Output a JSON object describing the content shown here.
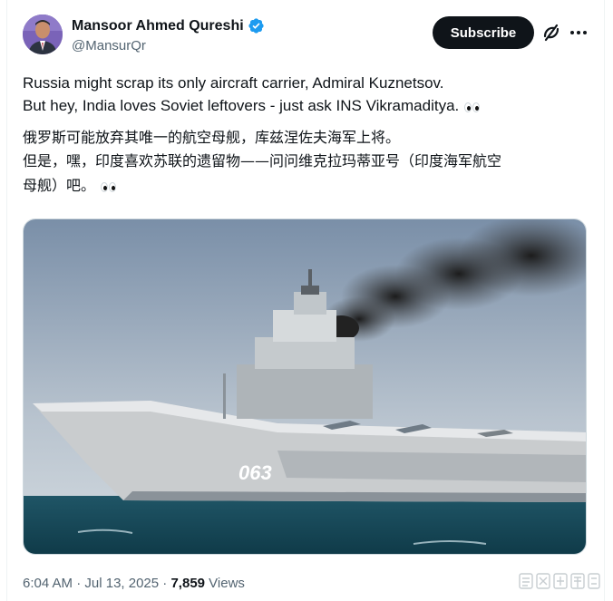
{
  "author": {
    "name": "Mansoor Ahmed Qureshi",
    "handle": "@MansurQr",
    "verified": true
  },
  "actions": {
    "subscribe_label": "Subscribe",
    "grok_icon": "grok-icon",
    "more_icon": "more-icon"
  },
  "post": {
    "line1": "Russia might scrap its only aircraft carrier, Admiral Kuznetsov.",
    "line2": "But hey, India loves Soviet leftovers - just ask INS Vikramaditya.",
    "line3": "俄罗斯可能放弃其唯一的航空母舰，库兹涅佐夫海军上将。",
    "line4": "但是，嘿，印度喜欢苏联的遗留物——问问维克拉玛蒂亚号（印度海军航空",
    "line5": "母舰）吧。",
    "emoji": "eyes-emoji"
  },
  "media": {
    "hull_number": "063"
  },
  "meta": {
    "time": "6:04 AM",
    "separator": " · ",
    "date": "Jul 13, 2025",
    "views_count": "7,859",
    "views_label": " Views"
  },
  "colors": {
    "accent_verified": "#1d9bf0",
    "subscribe_bg": "#0f1419",
    "secondary_text": "#536471"
  }
}
